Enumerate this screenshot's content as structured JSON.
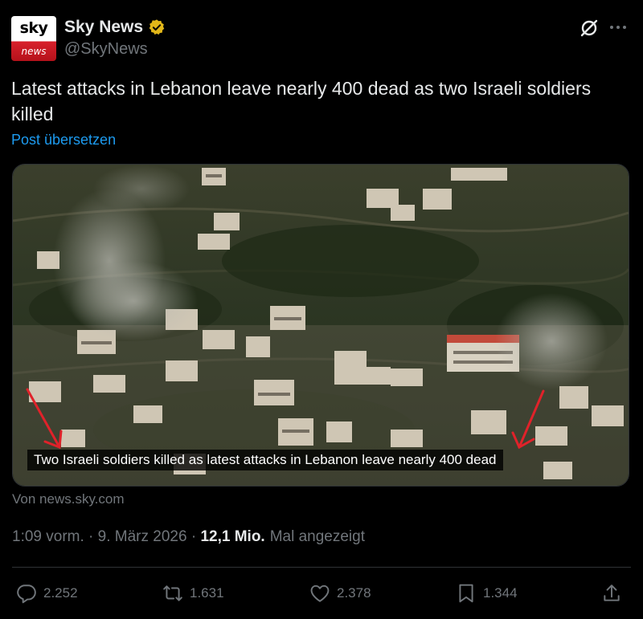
{
  "account": {
    "avatar_top": "sky",
    "avatar_bottom": "news",
    "name": "Sky News",
    "handle": "@SkyNews",
    "verified_color": "#e2b719"
  },
  "post": {
    "text": "Latest attacks in Lebanon leave nearly 400 dead as two Israeli soldiers killed",
    "translate_label": "Post übersetzen",
    "image_caption": "Two Israeli soldiers killed as latest attacks in Lebanon leave nearly 400 dead",
    "source": "Von news.sky.com"
  },
  "meta": {
    "time": "1:09 vorm.",
    "separator": " · ",
    "date": "9. März 2026",
    "views": "12,1 Mio.",
    "views_label": "Mal angezeigt"
  },
  "actions": {
    "replies": "2.252",
    "reposts": "1.631",
    "likes": "2.378",
    "bookmarks": "1.344"
  },
  "icons": [
    "grok-icon",
    "more-icon",
    "reply-icon",
    "repost-icon",
    "like-icon",
    "bookmark-icon",
    "share-icon",
    "verified-icon"
  ],
  "colors": {
    "background": "#000000",
    "text": "#e7e9ea",
    "muted": "#71767b",
    "link": "#1d9bf0",
    "arrow": "#e0222a"
  }
}
